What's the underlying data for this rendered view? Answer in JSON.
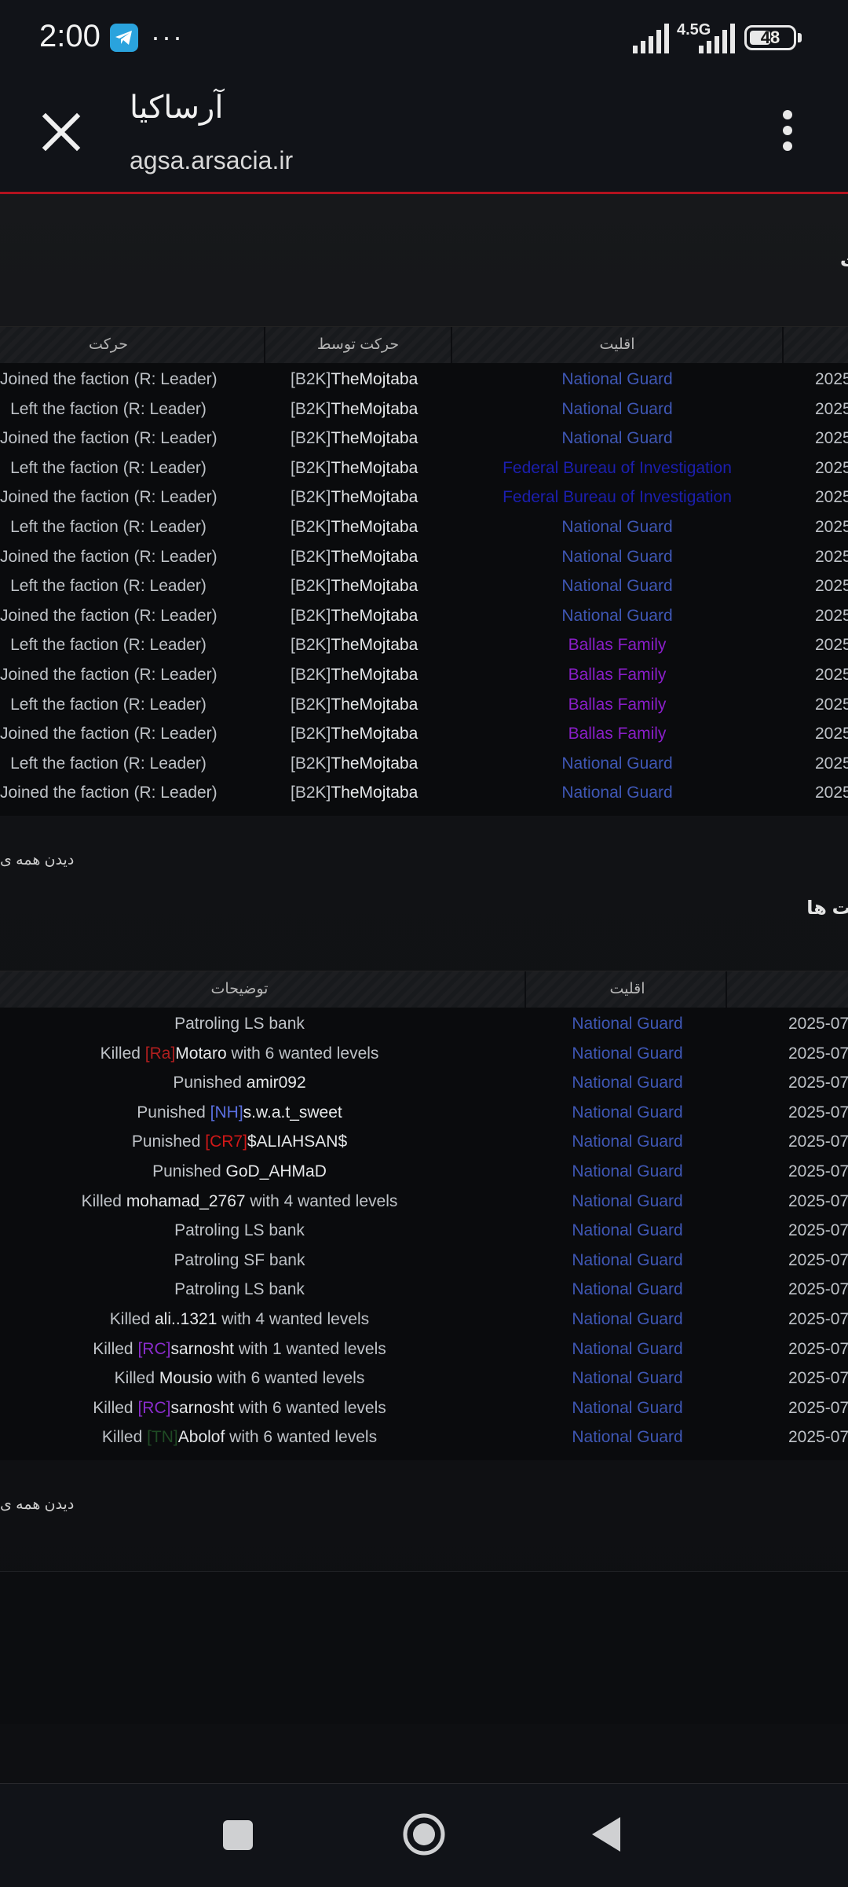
{
  "status": {
    "time": "2:00",
    "network": "4.5G",
    "battery": "48"
  },
  "header": {
    "title": "آرساکیا",
    "url": "agsa.arsacia.ir"
  },
  "colors": {
    "national_guard": "#3f57b5",
    "fbi": "#1c1fb0",
    "ballas": "#8a1ec9",
    "clan_ra": "#b11f1f",
    "clan_nh": "#5a6fe0",
    "clan_cr7": "#d01818",
    "clan_rc": "#8a2ccc",
    "clan_tn": "#1f4a24",
    "accent_line": "#b3121f"
  },
  "section1": {
    "title": "ت",
    "headers": {
      "action": "حرکت",
      "by": "حرکت توسط",
      "faction": "اقلیت"
    },
    "rows": [
      {
        "action": "Joined the faction (R: Leader)",
        "clan": "[B2K]",
        "user": "TheMojtaba",
        "faction": "National Guard",
        "fkey": "national_guard",
        "date": "2025"
      },
      {
        "action": "Left the faction (R: Leader)",
        "clan": "[B2K]",
        "user": "TheMojtaba",
        "faction": "National Guard",
        "fkey": "national_guard",
        "date": "2025"
      },
      {
        "action": "Joined the faction (R: Leader)",
        "clan": "[B2K]",
        "user": "TheMojtaba",
        "faction": "National Guard",
        "fkey": "national_guard",
        "date": "2025"
      },
      {
        "action": "Left the faction (R: Leader)",
        "clan": "[B2K]",
        "user": "TheMojtaba",
        "faction": "Federal Bureau of Investigation",
        "fkey": "fbi",
        "date": "2025"
      },
      {
        "action": "Joined the faction (R: Leader)",
        "clan": "[B2K]",
        "user": "TheMojtaba",
        "faction": "Federal Bureau of Investigation",
        "fkey": "fbi",
        "date": "2025"
      },
      {
        "action": "Left the faction (R: Leader)",
        "clan": "[B2K]",
        "user": "TheMojtaba",
        "faction": "National Guard",
        "fkey": "national_guard",
        "date": "2025"
      },
      {
        "action": "Joined the faction (R: Leader)",
        "clan": "[B2K]",
        "user": "TheMojtaba",
        "faction": "National Guard",
        "fkey": "national_guard",
        "date": "2025"
      },
      {
        "action": "Left the faction (R: Leader)",
        "clan": "[B2K]",
        "user": "TheMojtaba",
        "faction": "National Guard",
        "fkey": "national_guard",
        "date": "2025"
      },
      {
        "action": "Joined the faction (R: Leader)",
        "clan": "[B2K]",
        "user": "TheMojtaba",
        "faction": "National Guard",
        "fkey": "national_guard",
        "date": "2025"
      },
      {
        "action": "Left the faction (R: Leader)",
        "clan": "[B2K]",
        "user": "TheMojtaba",
        "faction": "Ballas Family",
        "fkey": "ballas",
        "date": "2025"
      },
      {
        "action": "Joined the faction (R: Leader)",
        "clan": "[B2K]",
        "user": "TheMojtaba",
        "faction": "Ballas Family",
        "fkey": "ballas",
        "date": "2025"
      },
      {
        "action": "Left the faction (R: Leader)",
        "clan": "[B2K]",
        "user": "TheMojtaba",
        "faction": "Ballas Family",
        "fkey": "ballas",
        "date": "2025"
      },
      {
        "action": "Joined the faction (R: Leader)",
        "clan": "[B2K]",
        "user": "TheMojtaba",
        "faction": "Ballas Family",
        "fkey": "ballas",
        "date": "2025"
      },
      {
        "action": "Left the faction (R: Leader)",
        "clan": "[B2K]",
        "user": "TheMojtaba",
        "faction": "National Guard",
        "fkey": "national_guard",
        "date": "2025"
      },
      {
        "action": "Joined the faction (R: Leader)",
        "clan": "[B2K]",
        "user": "TheMojtaba",
        "faction": "National Guard",
        "fkey": "national_guard",
        "date": "2025"
      }
    ],
    "view_all": "دیدن همه ی"
  },
  "section2": {
    "title": "یت ها",
    "headers": {
      "description": "توضیحات",
      "faction": "اقلیت"
    },
    "rows": [
      {
        "pre": "Patroling LS bank",
        "clan": "",
        "ckey": "",
        "user": "",
        "post": "",
        "faction": "National Guard",
        "date": "2025-07"
      },
      {
        "pre": "Killed ",
        "clan": "[Ra]",
        "ckey": "clan_ra",
        "user": "Motaro",
        "post": " with 6 wanted levels",
        "faction": "National Guard",
        "date": "2025-07"
      },
      {
        "pre": "Punished ",
        "clan": "",
        "ckey": "",
        "user": "amir092",
        "post": "",
        "faction": "National Guard",
        "date": "2025-07"
      },
      {
        "pre": "Punished ",
        "clan": "[NH]",
        "ckey": "clan_nh",
        "user": "s.w.a.t_sweet",
        "post": "",
        "faction": "National Guard",
        "date": "2025-07"
      },
      {
        "pre": "Punished ",
        "clan": "[CR7]",
        "ckey": "clan_cr7",
        "user": "$ALIAHSAN$",
        "post": "",
        "faction": "National Guard",
        "date": "2025-07"
      },
      {
        "pre": "Punished ",
        "clan": "",
        "ckey": "",
        "user": "GoD_AHMaD",
        "post": "",
        "faction": "National Guard",
        "date": "2025-07"
      },
      {
        "pre": "Killed ",
        "clan": "",
        "ckey": "",
        "user": "mohamad_2767",
        "post": " with 4 wanted levels",
        "faction": "National Guard",
        "date": "2025-07"
      },
      {
        "pre": "Patroling LS bank",
        "clan": "",
        "ckey": "",
        "user": "",
        "post": "",
        "faction": "National Guard",
        "date": "2025-07"
      },
      {
        "pre": "Patroling SF bank",
        "clan": "",
        "ckey": "",
        "user": "",
        "post": "",
        "faction": "National Guard",
        "date": "2025-07"
      },
      {
        "pre": "Patroling LS bank",
        "clan": "",
        "ckey": "",
        "user": "",
        "post": "",
        "faction": "National Guard",
        "date": "2025-07"
      },
      {
        "pre": "Killed ",
        "clan": "",
        "ckey": "",
        "user": "ali..1321",
        "post": " with 4 wanted levels",
        "faction": "National Guard",
        "date": "2025-07"
      },
      {
        "pre": "Killed ",
        "clan": "[RC]",
        "ckey": "clan_rc",
        "user": "sarnosht",
        "post": " with 1 wanted levels",
        "faction": "National Guard",
        "date": "2025-07"
      },
      {
        "pre": "Killed ",
        "clan": "",
        "ckey": "",
        "user": "Mousio",
        "post": " with 6 wanted levels",
        "faction": "National Guard",
        "date": "2025-07"
      },
      {
        "pre": "Killed ",
        "clan": "[RC]",
        "ckey": "clan_rc",
        "user": "sarnosht",
        "post": " with 6 wanted levels",
        "faction": "National Guard",
        "date": "2025-07"
      },
      {
        "pre": "Killed ",
        "clan": "[TN]",
        "ckey": "clan_tn",
        "user": "Abolof",
        "post": " with 6 wanted levels",
        "faction": "National Guard",
        "date": "2025-07"
      }
    ],
    "view_all": "دیدن همه ی"
  },
  "icons": {
    "close": "close-icon",
    "menu": "more-vertical-icon",
    "telegram": "telegram-icon",
    "recents": "square-icon",
    "home": "circle-icon",
    "back": "triangle-back-icon"
  }
}
